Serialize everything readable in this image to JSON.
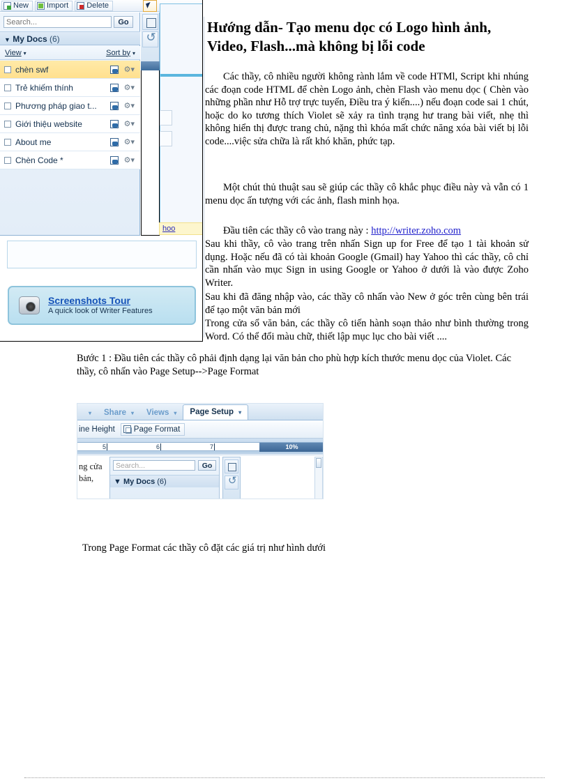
{
  "document": {
    "title": "Hướng dẫn- Tạo menu dọc có Logo hình ảnh, Video, Flash...mà không bị lỗi code",
    "paragraphs": [
      "Các thầy, cô nhiều người không rành lắm về code HTMl, Script khi nhúng các đoạn code HTML để chèn Logo ảnh, chèn Flash vào menu dọc ( Chèn vào những phần như Hỗ trợ trực tuyến, Điều tra ý kiến....) nếu đoạn code sai 1 chút, hoặc do ko tương thích Violet sẽ xảy ra tình trạng hư trang bài viết, nhẹ thì không hiển thị được trang chủ, nặng thì khóa mất chức năng xóa bài viết bị lỗi code....việc sửa chữa là rất khó khăn, phức tạp.",
      "Một chút thủ thuật sau sẽ giúp các thầy cô khắc phục điều này và vẫn có 1 menu dọc ấn tượng với các ảnh, flash minh họa."
    ],
    "link_lead": "Đầu tiên các thầy cô vào trang này : ",
    "link_text": "http://writer.zoho.com",
    "paragraph_after_link": "Sau khi thầy, cô vào trang trên nhấn Sign up for Free để tạo 1 tài khoản sử dụng. Hoặc nếu đã có tài khoản Google (Gmail) hay Yahoo thì các thầy, cô chỉ cần nhấn vào mục Sign in using Google or Yahoo ở dưới là vào được Zoho Writer.",
    "paragraph_new": "Sau khi đã đăng nhập vào, các thầy cô nhấn vào New ở góc trên cùng bên trái để tạo một văn bản mới",
    "paragraph_editor": "Trong cửa sổ văn bản, các thầy cô tiến hành soạn thảo như bình thường trong Word. Có thể đổi màu chữ, thiết lập mục lục cho bài viết ....",
    "step1": "Bước 1 :   Đầu tiên các thầy cô phải định dạng lại văn bản cho phù hợp kích thước menu dọc của Violet. Các thầy, cô nhấn vào Page Setup-->Page Format",
    "closing": "Trong Page Format các thầy cô đặt các giá trị như hình dưới"
  },
  "screenshot1": {
    "toolbar": [
      {
        "label": "New",
        "icon": "new-document-icon"
      },
      {
        "label": "Import",
        "icon": "import-document-icon"
      },
      {
        "label": "Delete",
        "icon": "delete-document-icon"
      }
    ],
    "collapse_icon": "collapse-arrow-icon",
    "search": {
      "value": "",
      "placeholder": "Search...",
      "go_label": "Go"
    },
    "my_docs": {
      "label": "My Docs",
      "count": "(6)",
      "triangle": "▼"
    },
    "view_label": "View",
    "sort_label": "Sort by",
    "documents": [
      {
        "name": "chèn swf",
        "selected": true
      },
      {
        "name": "Trẻ khiếm thính",
        "selected": false
      },
      {
        "name": "Phương pháp giao t...",
        "selected": false
      },
      {
        "name": "Giới thiệu website",
        "selected": false
      },
      {
        "name": "About me",
        "selected": false
      },
      {
        "name": "Chèn Code *",
        "selected": false
      }
    ],
    "row_icons": {
      "share": "share-document-icon",
      "settings": "gear-dropdown-icon"
    },
    "side_tools": [
      {
        "name": "save-icon"
      },
      {
        "name": "refresh-icon"
      }
    ],
    "yahoo_fragment": "hoo",
    "tour": {
      "title": "Screenshots Tour",
      "subtitle": "A quick look of Writer Features",
      "icon": "camera-icon"
    }
  },
  "screenshot2": {
    "tabs": [
      {
        "label": "Share",
        "active": false,
        "caret": "▾"
      },
      {
        "label": "Views",
        "active": false,
        "caret": "▾"
      },
      {
        "label": "Page Setup",
        "active": true,
        "caret": "▾"
      }
    ],
    "subtoolbar": {
      "line_height_label": "ine Height",
      "page_format_label": "Page Format",
      "page_format_icon": "page-format-icon"
    },
    "ruler": {
      "ticks": [
        "5",
        "6",
        "7"
      ],
      "zoom_label": "10%"
    },
    "doc_fragment": [
      "ng cửa",
      "bản,"
    ],
    "pane": {
      "search_placeholder": "Search...",
      "go_label": "Go",
      "my_docs_label": "My Docs",
      "my_docs_count": "(6)",
      "triangle": "▼"
    },
    "side_tools": [
      {
        "name": "save-icon"
      },
      {
        "name": "refresh-icon"
      }
    ],
    "scrollbar": "vertical-scrollbar"
  },
  "colors": {
    "accent_blue": "#1552b8",
    "selected_row": "#ffe08e",
    "panel_blue": "#cddff0",
    "zoom_band": "#3c6695"
  }
}
